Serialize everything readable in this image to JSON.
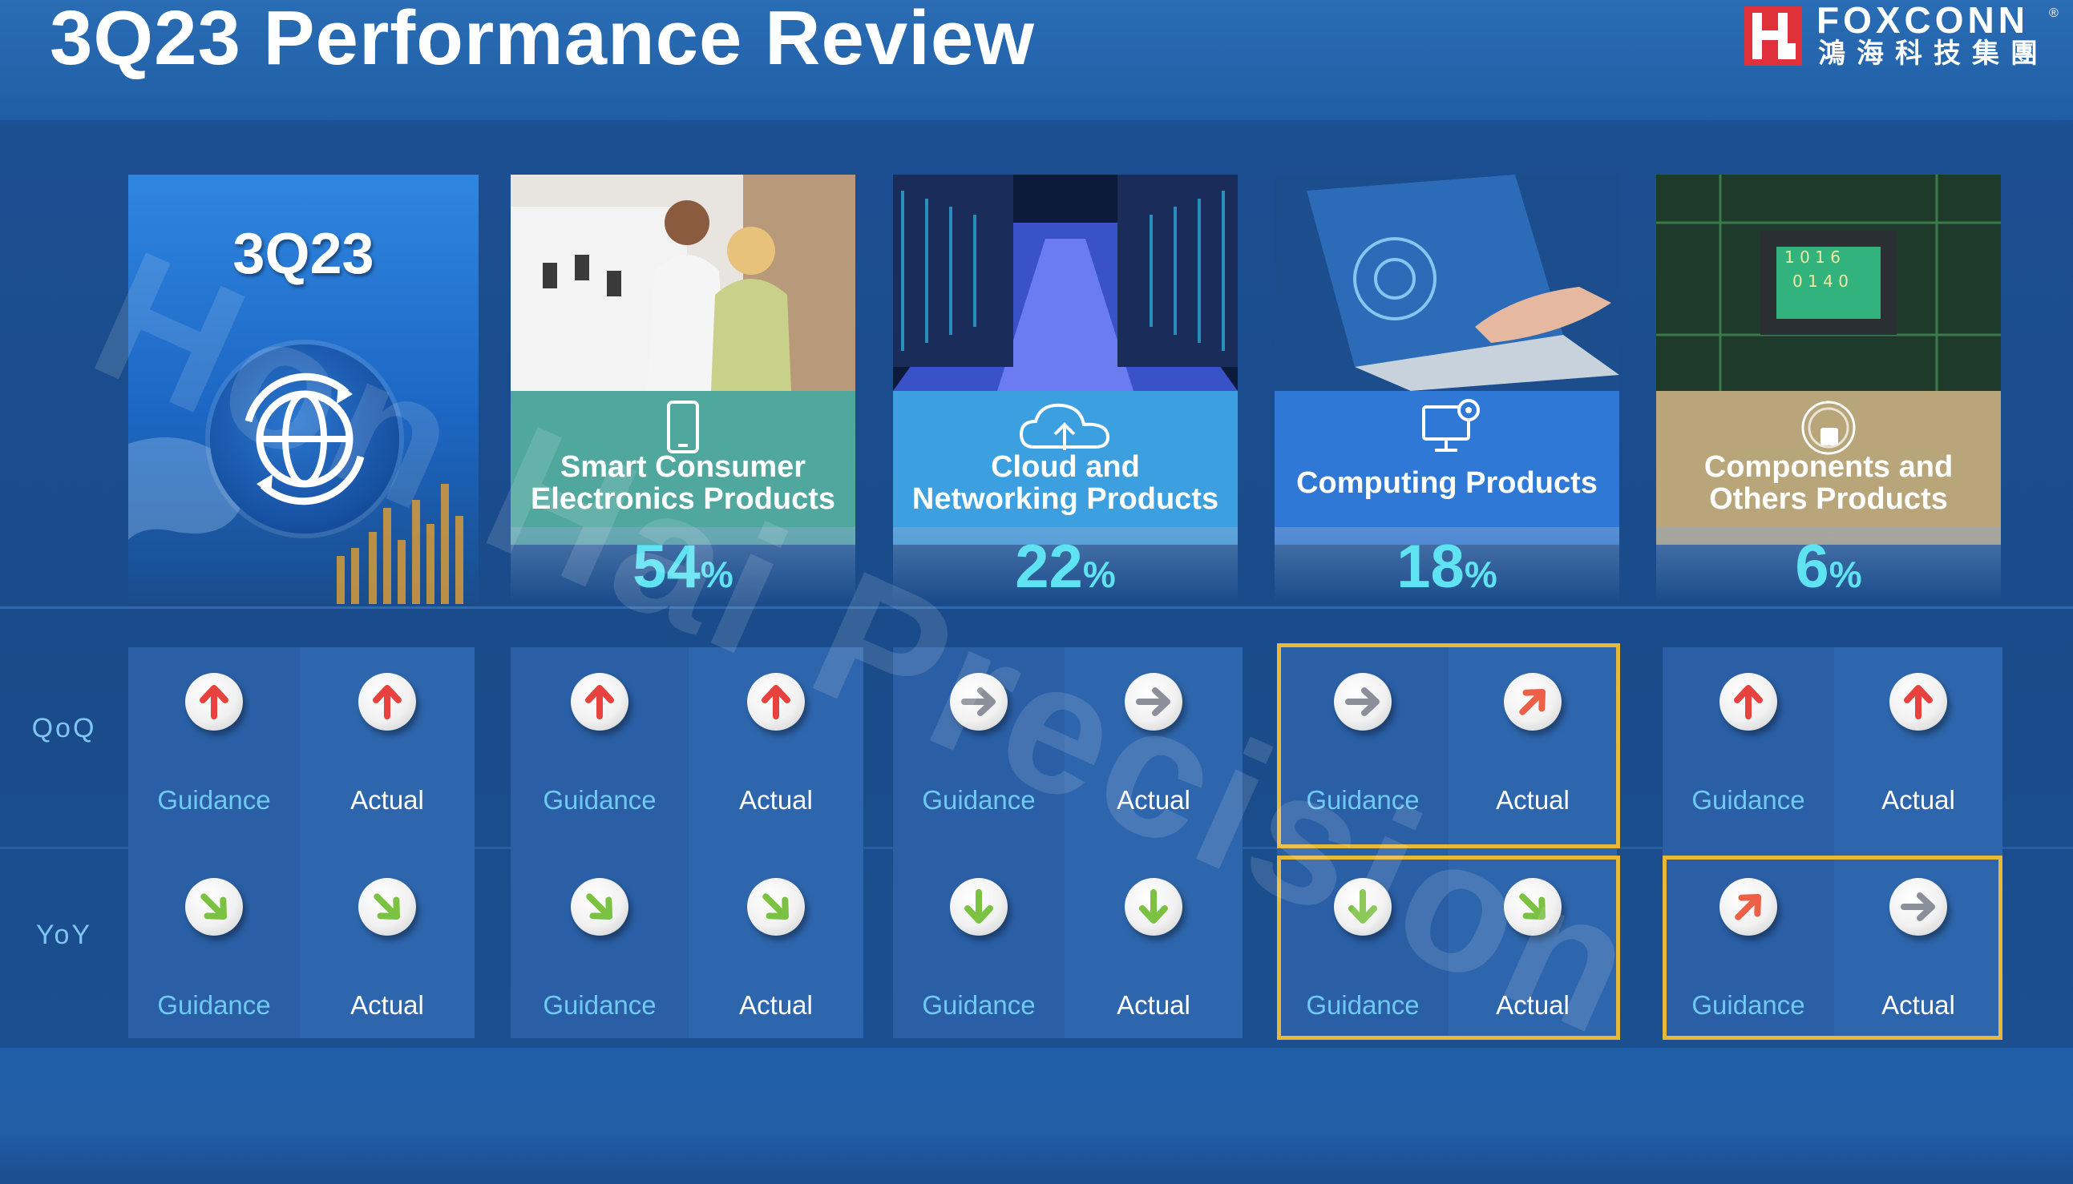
{
  "title": "3Q23 Performance Review",
  "logo": {
    "brand": "FOXCONN",
    "registered": "®",
    "chinese": "鴻海科技集團"
  },
  "watermark": "Hon Hai Precision",
  "main_card": {
    "label": "3Q23"
  },
  "segments": [
    {
      "name": "Smart Consumer\nElectronics Products",
      "pct": "54",
      "unit": "%",
      "label_color": "#4fa79e",
      "icon": "tablet-icon"
    },
    {
      "name": "Cloud and\nNetworking Products",
      "pct": "22",
      "unit": "%",
      "label_color": "#3c9fe0",
      "icon": "cloud-upload-icon"
    },
    {
      "name": "Computing Products",
      "pct": "18",
      "unit": "%",
      "label_color": "#2f78d6",
      "icon": "monitor-gear-icon"
    },
    {
      "name": "Components and\nOthers Products",
      "pct": "6",
      "unit": "%",
      "label_color": "#b8a57a",
      "icon": "chip-icon"
    }
  ],
  "rows": {
    "qoq": "QoQ",
    "yoy": "YoY"
  },
  "labels": {
    "guidance": "Guidance",
    "actual": "Actual"
  },
  "grid": [
    {
      "qoq": {
        "guidance": "up",
        "actual": "up"
      },
      "yoy": {
        "guidance": "down-right",
        "actual": "down-right"
      }
    },
    {
      "qoq": {
        "guidance": "up",
        "actual": "up"
      },
      "yoy": {
        "guidance": "down-right",
        "actual": "down-right"
      }
    },
    {
      "qoq": {
        "guidance": "right",
        "actual": "right"
      },
      "yoy": {
        "guidance": "down",
        "actual": "down"
      }
    },
    {
      "qoq": {
        "guidance": "right",
        "actual": "up-right"
      },
      "yoy": {
        "guidance": "down",
        "actual": "down-right"
      }
    },
    {
      "qoq": {
        "guidance": "up",
        "actual": "up"
      },
      "yoy": {
        "guidance": "up-right",
        "actual": "right"
      }
    }
  ],
  "arrow_colors": {
    "up": "#e8423e",
    "up-right": "#ec6048",
    "right": "#8a8f99",
    "down-right": "#7cc242",
    "down": "#7cc242"
  },
  "highlight_color": "#e8b83a"
}
